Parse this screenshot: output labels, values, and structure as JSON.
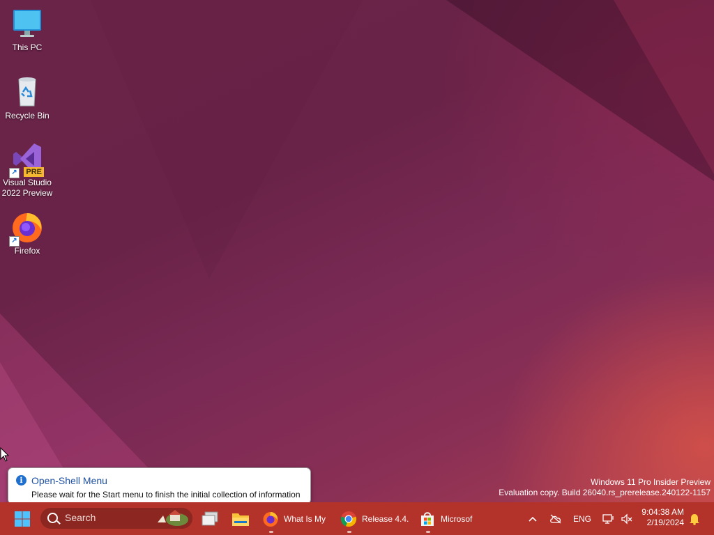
{
  "desktop": {
    "icons": [
      {
        "label": "This PC",
        "icon": "monitor-icon"
      },
      {
        "label": "Recycle Bin",
        "icon": "recycle-bin-icon"
      },
      {
        "label": "Visual Studio 2022 Preview",
        "icon": "visual-studio-icon",
        "badge": "PRE"
      },
      {
        "label": "Firefox",
        "icon": "firefox-icon"
      }
    ],
    "watermark": {
      "line1": "Windows 11 Pro Insider Preview",
      "line2": "Evaluation copy. Build 26040.rs_prerelease.240122-1157"
    }
  },
  "tooltip": {
    "title": "Open-Shell Menu",
    "body": "Please wait for the Start menu to finish the initial collection of information",
    "icon": "info-icon"
  },
  "taskbar": {
    "search_label": "Search",
    "apps": [
      {
        "label": "",
        "icon": "task-view-icon",
        "running": false
      },
      {
        "label": "",
        "icon": "file-explorer-icon",
        "running": false
      },
      {
        "label": "What Is My",
        "icon": "firefox-icon",
        "running": true
      },
      {
        "label": "Release 4.4.",
        "icon": "chrome-icon",
        "running": true
      },
      {
        "label": "Microsof",
        "icon": "microsoft-store-icon",
        "running": true
      }
    ],
    "tray": {
      "language": "ENG",
      "time": "9:04:38 AM",
      "date": "2/19/2024"
    },
    "colors": {
      "taskbar": "#b3322a",
      "search": "#8b2620"
    }
  }
}
